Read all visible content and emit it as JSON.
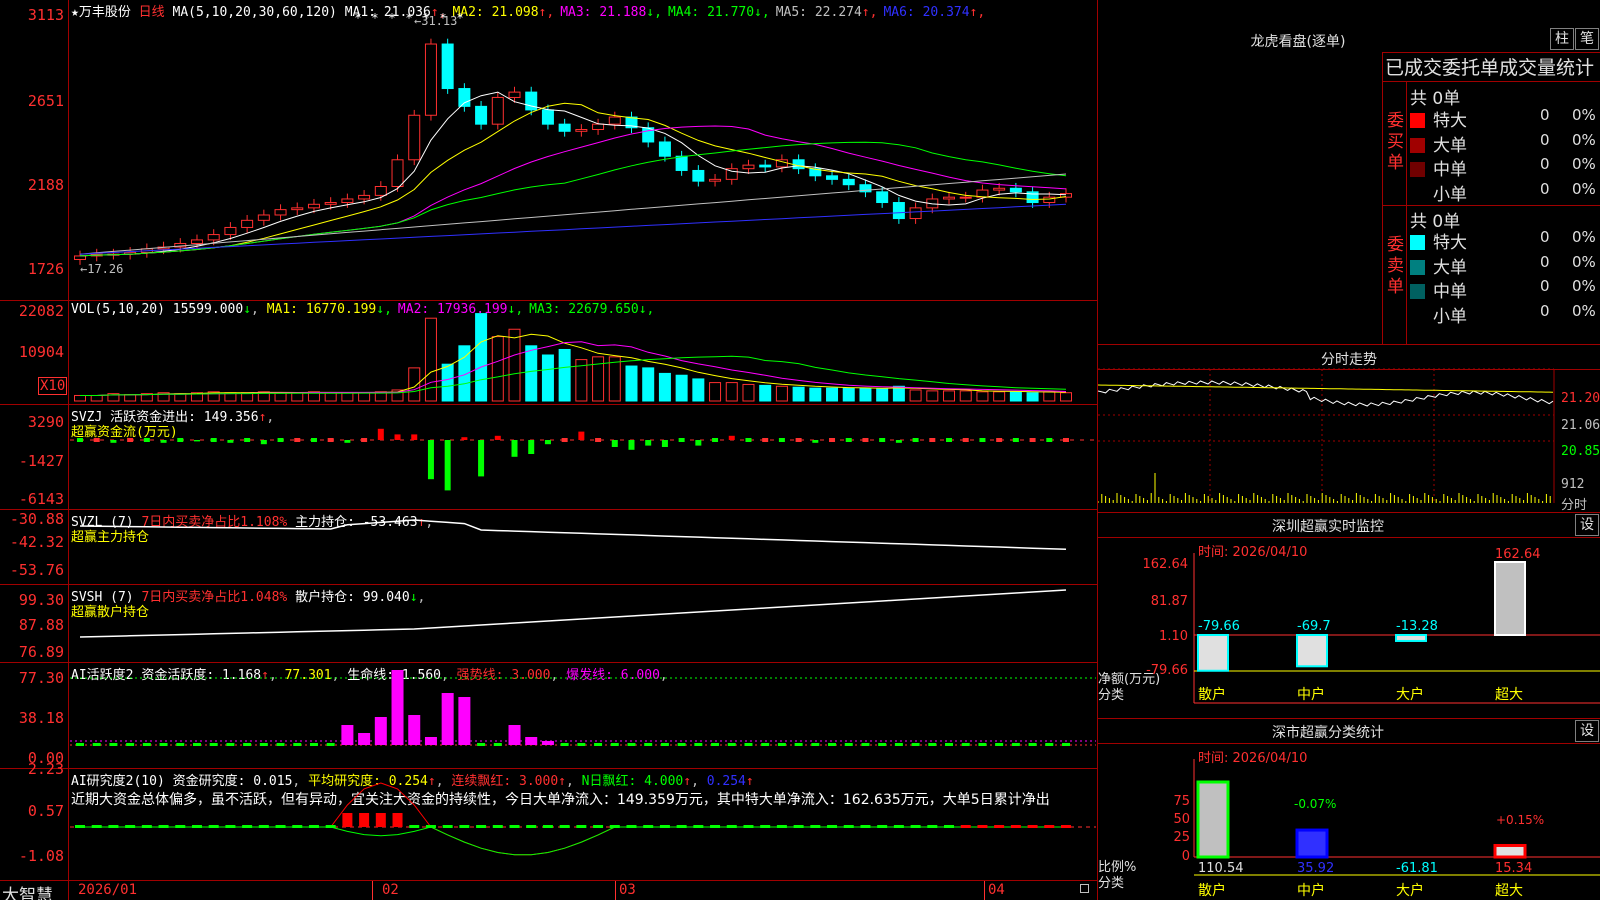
{
  "main": {
    "stock_name": "★万丰股份",
    "period": "日线",
    "ma_params": "MA(5,10,20,30,60,120)",
    "ma": [
      {
        "label": "MA1:",
        "value": "21.036",
        "arrow": "↑",
        "color": "#ffffff"
      },
      {
        "label": "MA2:",
        "value": "21.098",
        "arrow": "↑",
        "color": "#ffff00"
      },
      {
        "label": "MA3:",
        "value": "21.188",
        "arrow": "↓",
        "color": "#ff00ff"
      },
      {
        "label": "MA4:",
        "value": "21.770",
        "arrow": "↓",
        "color": "#00ff00"
      },
      {
        "label": "MA5:",
        "value": "22.274",
        "arrow": "↑",
        "color": "#c0c0c0"
      },
      {
        "label": "MA6:",
        "value": "20.374",
        "arrow": "↑",
        "color": "#3030ff"
      }
    ],
    "y_labels": [
      "3113",
      "2651",
      "2188",
      "1726"
    ],
    "high_mark": "31.13",
    "low_mark": "17.26"
  },
  "vol": {
    "params": "VOL(5,10,20)",
    "value": "15599.000",
    "arrow": "↓",
    "ma": [
      {
        "label": "MA1:",
        "value": "16770.199",
        "arrow": "↓",
        "color": "#ffff00"
      },
      {
        "label": "MA2:",
        "value": "17936.199",
        "arrow": "↓",
        "color": "#ff00ff"
      },
      {
        "label": "MA3:",
        "value": "22679.650",
        "arrow": "↓",
        "color": "#00ff00"
      }
    ],
    "y_labels": [
      "22082",
      "10904"
    ],
    "unit": "X10"
  },
  "svzj": {
    "name": "SVZJ",
    "label": "活跃资金进出:",
    "value": "149.356",
    "arrow": "↑",
    "sub": "超赢资金流(万元)",
    "y_labels": [
      "3290",
      "-1427",
      "-6143"
    ]
  },
  "svzl": {
    "name": "SVZL (7)",
    "desc": "7日内买卖净占比1.108%",
    "label": "主力持仓:",
    "value": "-53.463",
    "arrow": "↑",
    "sub": "超赢主力持仓",
    "y_labels": [
      "-30.88",
      "-42.32",
      "-53.76"
    ]
  },
  "svsh": {
    "name": "SVSH (7)",
    "desc": "7日内买卖净占比1.048%",
    "label": "散户持仓:",
    "value": "99.040",
    "arrow": "↓",
    "sub": "超赢散户持仓",
    "y_labels": [
      "99.30",
      "87.88",
      "76.89"
    ]
  },
  "ai_active": {
    "name": "AI活跃度2",
    "label": "资金活跃度:",
    "value": "1.168",
    "v2": "77.301",
    "life_label": "生命线:",
    "life": "1.560",
    "strong_label": "强势线:",
    "strong": "3.000",
    "burst_label": "爆发线:",
    "burst": "6.000",
    "y_labels": [
      "77.30",
      "38.18",
      "0.00"
    ]
  },
  "ai_research": {
    "name": "AI研究度2(10)",
    "label": "资金研究度:",
    "value": "0.015",
    "avg_label": "平均研究度:",
    "avg": "0.254",
    "streak_label": "连续飘红:",
    "streak": "3.000",
    "nday_label": "N日飘红:",
    "nday": "4.000",
    "last": "0.254",
    "comment": "近期大资金总体偏多，虽不活跃，但有异动，宜关注大资金的持续性，今日大单净流入：149.359万元，其中特大单净流入：162.635万元，大单5日累计净出",
    "y_labels": [
      "2.23",
      "0.57",
      "-1.08"
    ]
  },
  "bottom": {
    "brand": "大智慧",
    "dates": [
      "2026/01",
      "02",
      "03",
      "04"
    ]
  },
  "right": {
    "lhb_title": "龙虎看盘(逐单)",
    "btn_bar": "柱",
    "btn_pen": "笔",
    "stats_title": "已成交委托单成交量统计",
    "buy_label": "委买单",
    "sell_label": "委卖单",
    "buy_total": "共 0单",
    "sell_total": "共 0单",
    "buy_rows": [
      {
        "name": "特大",
        "color": "#ff0000",
        "count": "0",
        "pct": "0%"
      },
      {
        "name": "大单",
        "color": "#a00000",
        "count": "0",
        "pct": "0%"
      },
      {
        "name": "中单",
        "color": "#700000",
        "count": "0",
        "pct": "0%"
      },
      {
        "name": "小单",
        "color": "#000000",
        "count": "0",
        "pct": "0%"
      }
    ],
    "sell_rows": [
      {
        "name": "特大",
        "color": "#00ffff",
        "count": "0",
        "pct": "0%"
      },
      {
        "name": "大单",
        "color": "#008080",
        "count": "0",
        "pct": "0%"
      },
      {
        "name": "中单",
        "color": "#006060",
        "count": "0",
        "pct": "0%"
      },
      {
        "name": "小单",
        "color": "#000000",
        "count": "0",
        "pct": "0%"
      }
    ],
    "intraday_title": "分时走势",
    "intraday_labels": [
      "21.20",
      "21.06",
      "20.85"
    ],
    "intraday_vol": "912",
    "intraday_vol_unit": "分时",
    "monitor_title": "深圳超赢实时监控",
    "monitor_btn": "设",
    "monitor_time": "时间: 2026/04/10",
    "monitor_y": [
      "162.64",
      "81.87",
      "1.10",
      "-79.66"
    ],
    "monitor_axis_label": "净额(万元)",
    "monitor_cat_label": "分类",
    "monitor_values": [
      "-79.66",
      "-69.7",
      "-13.28",
      "162.64"
    ],
    "monitor_cats": [
      "散户",
      "中户",
      "大户",
      "超大"
    ],
    "classify_title": "深市超赢分类统计",
    "classify_btn": "设",
    "classify_time": "时间: 2026/04/10",
    "classify_y": [
      "75",
      "50",
      "25",
      "0"
    ],
    "classify_axis_label": "比例%",
    "classify_cat_label": "分类",
    "classify_top": [
      "-0.07%",
      "+0.15%"
    ],
    "classify_values": [
      "110.54",
      "35.92",
      "-61.81",
      "15.34"
    ],
    "classify_cats": [
      "散户",
      "中户",
      "大户",
      "超大"
    ]
  }
}
